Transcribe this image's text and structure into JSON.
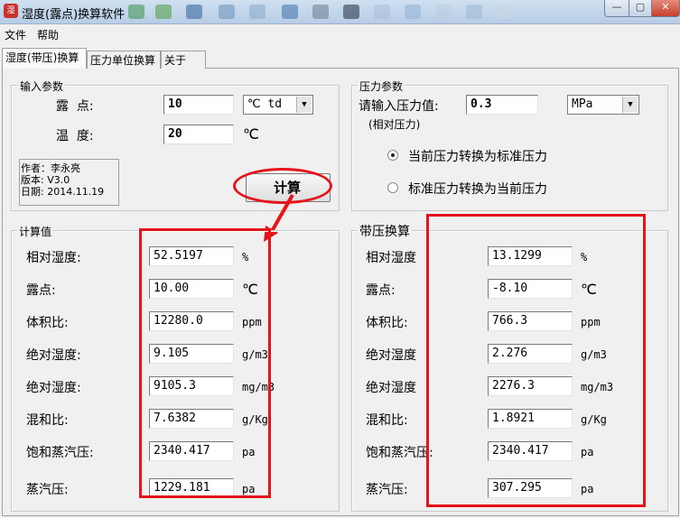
{
  "window": {
    "title": "湿度(露点)换算软件",
    "app_icon": "湿",
    "controls": {
      "minimize": "—",
      "maximize": "▢",
      "close": "✕"
    }
  },
  "menu": [
    "文件",
    "帮助"
  ],
  "tabs": [
    "湿度(带压)换算",
    "压力单位换算",
    "关于"
  ],
  "input_group": {
    "legend": "输入参数",
    "dewpoint_label": "露  点:",
    "dewpoint_value": "10",
    "dewpoint_unit": "℃ td",
    "temperature_label": "温  度:",
    "temperature_value": "20",
    "temperature_unit": "℃"
  },
  "info": {
    "author": "作者：李永亮",
    "version": "版本: V3.0",
    "date": "日期: 2014.11.19"
  },
  "calc_button": "计算",
  "pressure_group": {
    "legend": "压力参数",
    "prompt": "请输入压力值:",
    "value": "0.3",
    "unit": "MPa",
    "note": "(相对压力)",
    "option1": "当前压力转换为标准压力",
    "option2": "标准压力转换为当前压力",
    "selected": 1
  },
  "results": {
    "legend": "计算值",
    "rows": [
      {
        "label": "相对湿度:",
        "value": "52.5197",
        "unit": "%"
      },
      {
        "label": "露点:",
        "value": "10.00",
        "unit": "℃"
      },
      {
        "label": "体积比:",
        "value": "12280.0",
        "unit": "ppm"
      },
      {
        "label": "绝对湿度:",
        "value": "9.105",
        "unit": "g/m3"
      },
      {
        "label": "绝对湿度:",
        "value": "9105.3",
        "unit": "mg/m3"
      },
      {
        "label": "混和比:",
        "value": "7.6382",
        "unit": "g/Kg"
      },
      {
        "label": "饱和蒸汽压:",
        "value": "2340.417",
        "unit": "pa"
      },
      {
        "label": "蒸汽压:",
        "value": "1229.181",
        "unit": "pa"
      }
    ]
  },
  "pressurized": {
    "legend": "带压换算",
    "rows": [
      {
        "label": "相对湿度",
        "value": "13.1299",
        "unit": "%"
      },
      {
        "label": "露点:",
        "value": "-8.10",
        "unit": "℃"
      },
      {
        "label": "体积比:",
        "value": "766.3",
        "unit": "ppm"
      },
      {
        "label": "绝对湿度",
        "value": "2.276",
        "unit": "g/m3"
      },
      {
        "label": "绝对湿度",
        "value": "2276.3",
        "unit": "mg/m3"
      },
      {
        "label": "混和比:",
        "value": "1.8921",
        "unit": "g/Kg"
      },
      {
        "label": "饱和蒸汽压:",
        "value": "2340.417",
        "unit": "pa"
      },
      {
        "label": "蒸汽压:",
        "value": "307.295",
        "unit": "pa"
      }
    ]
  },
  "colors": {
    "annotation_red": "#e5141b",
    "title_gradient_top": "#cfe0f1"
  }
}
